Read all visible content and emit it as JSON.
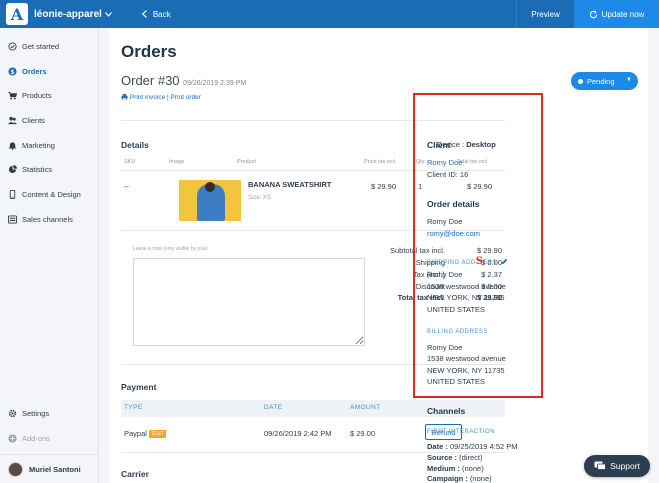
{
  "app": {
    "store_name": "léonie-apparel",
    "back_label": "Back",
    "preview_label": "Preview",
    "update_label": "Update now"
  },
  "sidebar": {
    "items": [
      {
        "label": "Get started",
        "icon": "check-circle-icon"
      },
      {
        "label": "Orders",
        "icon": "dollar-icon",
        "active": true
      },
      {
        "label": "Products",
        "icon": "cart-icon"
      },
      {
        "label": "Clients",
        "icon": "users-icon"
      },
      {
        "label": "Marketing",
        "icon": "bell-icon"
      },
      {
        "label": "Statistics",
        "icon": "chart-icon"
      },
      {
        "label": "Content & Design",
        "icon": "phone-icon"
      },
      {
        "label": "Sales channels",
        "icon": "grid-icon"
      }
    ],
    "settings_label": "Settings",
    "addons_label": "Add-ons",
    "user_name": "Muriel Santoni"
  },
  "page": {
    "title": "Orders",
    "order_number": "Order #30",
    "order_date": "09/26/2019 2:39 PM",
    "print_invoice": "Print invoice",
    "print_order": "Print order",
    "status": "Pending"
  },
  "details": {
    "title": "Details",
    "device_label": "Device :",
    "device_value": "Desktop",
    "columns": {
      "sku": "SKU",
      "image": "Image",
      "product": "Product",
      "price": "Price tax incl.",
      "qty": "Qty",
      "total": "Total tax incl."
    },
    "item": {
      "sku": "--",
      "name": "BANANA SWEATSHIRT",
      "size": "Size: XS",
      "price": "$ 29.90",
      "qty": "1",
      "total": "$ 29.90"
    },
    "note_placeholder": "Leave a note (only visible by you)",
    "totals": [
      {
        "label": "Subtotal tax incl.",
        "value": "$ 29.90"
      },
      {
        "label": "Shipping",
        "value": "$ 0.00"
      },
      {
        "label": "Tax (incl.)",
        "value": "$ 2.37"
      },
      {
        "label": "Discount",
        "value": "- $ 0.00"
      },
      {
        "label": "Total tax incl.",
        "value": "$ 29.90"
      }
    ]
  },
  "payment": {
    "title": "Payment",
    "columns": {
      "type": "TYPE",
      "date": "DATE",
      "amount": "AMOUNT"
    },
    "row": {
      "type": "Paypal",
      "badge": "TEST",
      "date": "09/26/2019 2:42 PM",
      "amount": "$ 29.00",
      "refund_label": "Refund"
    }
  },
  "carrier": {
    "title": "Carrier"
  },
  "client_panel": {
    "client_title": "Client",
    "client_name": "Romy Doe",
    "client_id": "Client ID: 16",
    "order_details_title": "Order details",
    "od_name": "Romy Doe",
    "od_email": "romy@doe.com",
    "shipping_caption_a": "SHIPPING ADD",
    "shipping_caption_s": "S",
    "shipping_caption_b": "ESS",
    "shipping": [
      "Romy Doe",
      "1538 westwood avenue",
      "NEW YORK, NY 11735",
      "UNITED STATES"
    ],
    "billing_caption": "BILLING ADDRESS",
    "billing": [
      "Romy Doe",
      "1538 westwood avenue",
      "NEW YORK, NY 11735",
      "UNITED STATES"
    ],
    "channels_title": "Channels",
    "first_interaction": "FIRST INTERACTION",
    "channel_lines": [
      {
        "label": "Date :",
        "value": "09/25/2019 4:52 PM"
      },
      {
        "label": "Source :",
        "value": "(direct)"
      },
      {
        "label": "Medium :",
        "value": "(none)"
      },
      {
        "label": "Campaign :",
        "value": "(none)"
      }
    ]
  },
  "support_label": "Support",
  "colors": {
    "brand": "#1a6cb4",
    "accent": "#1c8ae6",
    "highlight": "#e0281e",
    "test_badge": "#f5a623"
  }
}
